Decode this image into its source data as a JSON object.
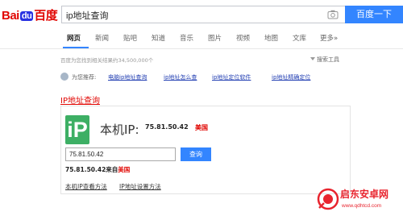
{
  "logo": {
    "bai": "Bai",
    "du": "du",
    "baidu": "百度"
  },
  "search": {
    "query": "ip地址查询",
    "button": "百度一下"
  },
  "tabs": [
    "网页",
    "新闻",
    "贴吧",
    "知道",
    "音乐",
    "图片",
    "视频",
    "地图",
    "文库",
    "更多»"
  ],
  "results": {
    "count_text": "百度为您找到相关结果约34,500,000个",
    "tools": "搜索工具"
  },
  "recommend": {
    "label": "为您推荐:",
    "links": [
      "电脑ip地址查询",
      "ip地址怎么查",
      "ip地址定位软件",
      "ip地址精确定位"
    ]
  },
  "card": {
    "title": "IP地址查询",
    "logo_text": "iP",
    "local_label": "本机IP:",
    "local_ip": "75.81.50.42",
    "local_country": "美国",
    "input_value": "75.81.50.42",
    "query_button": "查询",
    "result_prefix": "75.81.50.42来自",
    "result_location": "美国",
    "links": [
      "本机IP查看方法",
      "IP地址设置方法"
    ]
  },
  "watermark": {
    "title": "启东安卓网",
    "url": "www.qdhtcd.com"
  },
  "colors": {
    "accent": "#3385ff",
    "brand_red": "#e10602",
    "ip_green": "#3daf64"
  }
}
